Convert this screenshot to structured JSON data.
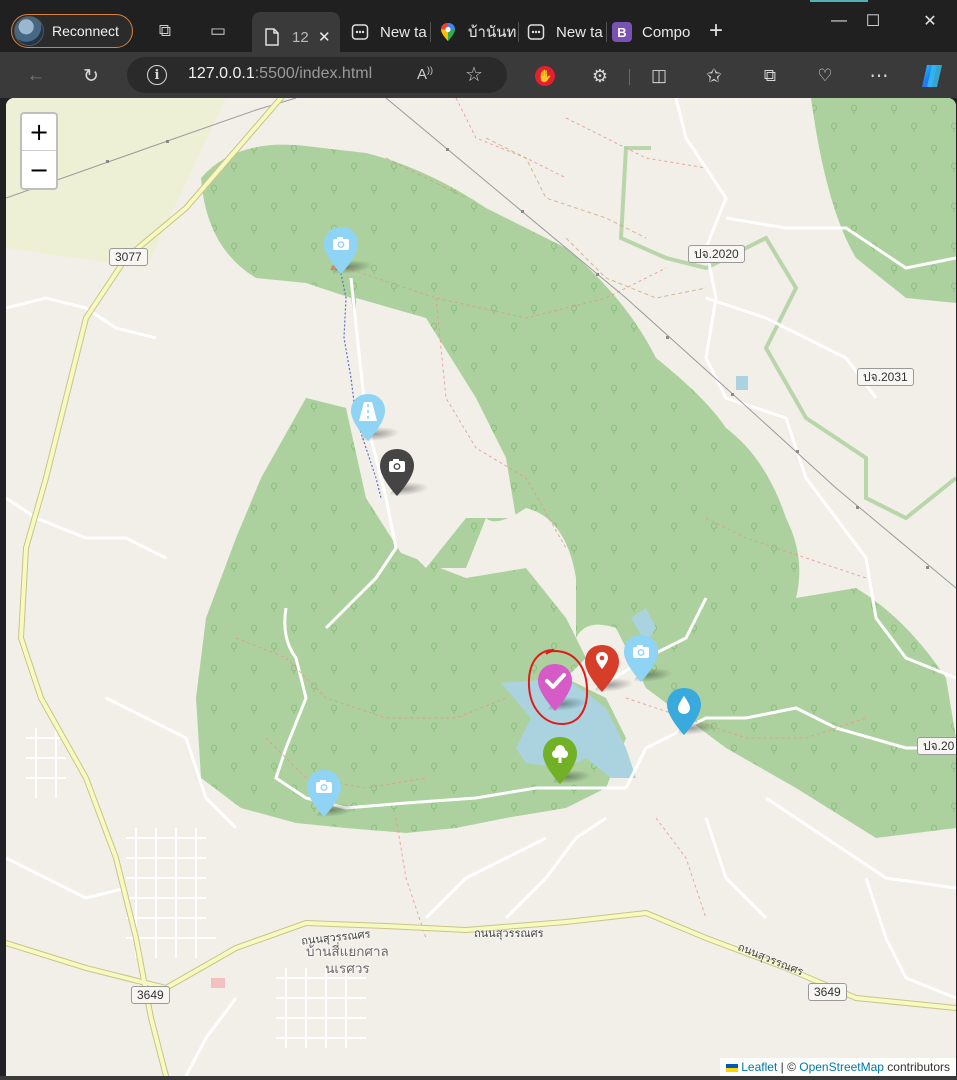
{
  "browser": {
    "profile_button": "Reconnect",
    "tabs": [
      {
        "label": "12",
        "icon": "file-icon",
        "active": true
      },
      {
        "label": "New ta",
        "icon": "newtab-icon"
      },
      {
        "label": "บ้านันท",
        "icon": "google-maps-icon"
      },
      {
        "label": "New ta",
        "icon": "newtab-icon"
      },
      {
        "label": "Compo",
        "icon": "bootstrap-icon"
      }
    ],
    "new_tab": "+",
    "url_host": "127.0.0.1",
    "url_rest": ":5500/index.html",
    "window": {
      "minimize": "—",
      "maximize": "☐",
      "close": "✕"
    }
  },
  "map": {
    "zoom_in": "+",
    "zoom_out": "−",
    "road_shields": [
      {
        "id": "3077",
        "text": "3077"
      },
      {
        "id": "2020",
        "text": "ปจ.2020"
      },
      {
        "id": "2031",
        "text": "ปจ.2031"
      },
      {
        "id": "20r",
        "text": "ปจ.20"
      },
      {
        "id": "3649a",
        "text": "3649"
      },
      {
        "id": "3649b",
        "text": "3649"
      }
    ],
    "road_labels": [
      "ถนนสุวรรณศร",
      "ถนนสุวรรณศร",
      "ถนนสุวรรณศร"
    ],
    "place_label": "บ้านสี่แยกศาล\nนเรศวร",
    "markers": [
      {
        "name": "camera",
        "icon": "camera-icon",
        "color": "#8fd3f5"
      },
      {
        "name": "road",
        "icon": "road-icon",
        "color": "#8fd3f5"
      },
      {
        "name": "camera-dark",
        "icon": "camera-icon",
        "color": "#454545"
      },
      {
        "name": "check-selected",
        "icon": "check-icon",
        "color": "#d65bc6"
      },
      {
        "name": "location",
        "icon": "pin-icon",
        "color": "#d63e2a"
      },
      {
        "name": "camera",
        "icon": "camera-icon",
        "color": "#8fd3f5"
      },
      {
        "name": "water",
        "icon": "water-drop-icon",
        "color": "#38aadd"
      },
      {
        "name": "tree",
        "icon": "tree-icon",
        "color": "#72b026"
      },
      {
        "name": "camera",
        "icon": "camera-icon",
        "color": "#8fd3f5"
      }
    ],
    "attribution": {
      "leaflet": "Leaflet",
      "separator": " | © ",
      "osm": "OpenStreetMap",
      "suffix": " contributors"
    }
  }
}
